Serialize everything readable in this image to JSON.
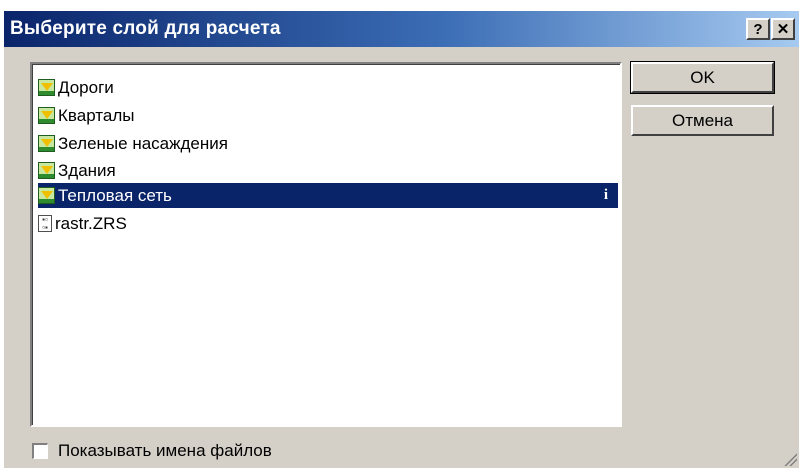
{
  "window": {
    "title": "Выберите слой для расчета",
    "help_label": "?",
    "close_label": "✕"
  },
  "layers": [
    {
      "label": "Дороги",
      "icon": "layer-icon"
    },
    {
      "label": "Кварталы",
      "icon": "layer-icon"
    },
    {
      "label": "Зеленые насаждения",
      "icon": "layer-icon"
    },
    {
      "label": "Здания",
      "icon": "layer-icon"
    },
    {
      "label": "Тепловая сеть",
      "icon": "layer-icon",
      "selected": true,
      "info_label": "i"
    },
    {
      "label": "rastr.ZRS",
      "icon": "raster-file-icon"
    }
  ],
  "buttons": {
    "ok_label": "OK",
    "cancel_label": "Отмена"
  },
  "options": {
    "show_filenames_label": "Показывать имена файлов",
    "show_filenames_checked": false
  },
  "colors": {
    "selection": "#0a246a",
    "titlebar_start": "#0a246a",
    "titlebar_end": "#a6caf0",
    "dialog_face": "#d4d0c8"
  }
}
